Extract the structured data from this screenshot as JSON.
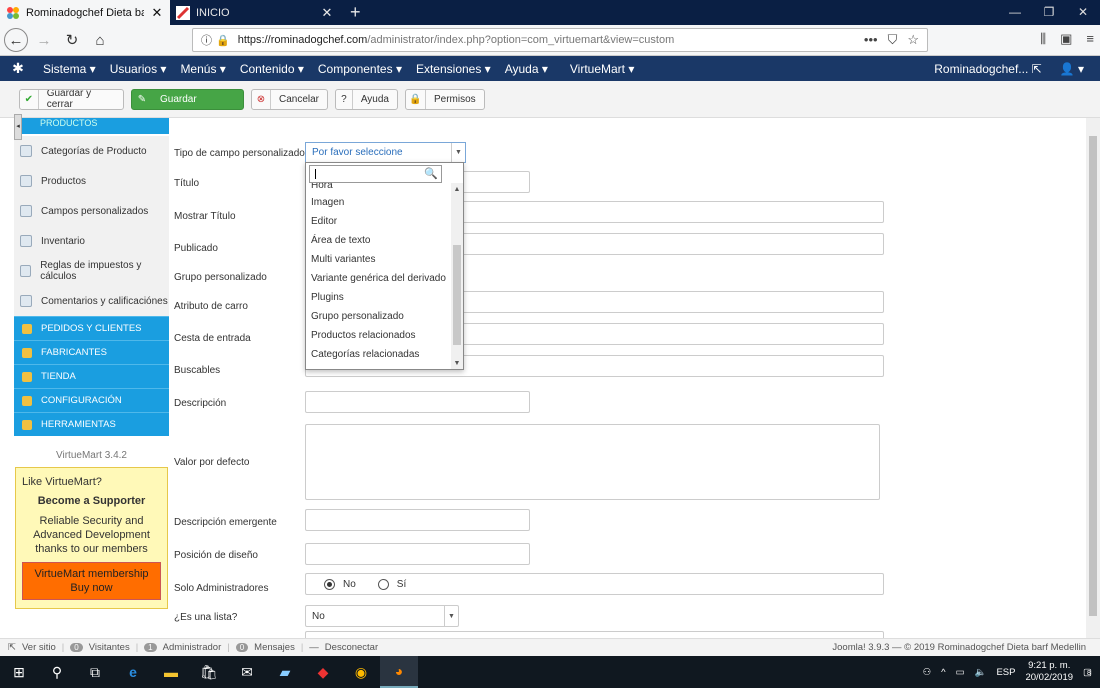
{
  "browser": {
    "tabs": [
      {
        "title": "Rominadogchef Dieta barf Me",
        "active": true
      },
      {
        "title": "INICIO",
        "active": false
      }
    ],
    "new_tab": "+",
    "url_domain": "https://rominadogchef.com",
    "url_path": "/administrator/index.php?option=com_virtuemart&view=custom",
    "url_actions": "•••"
  },
  "joomla_menu": {
    "items": [
      "Sistema ▾",
      "Usuarios ▾",
      "Menús ▾",
      "Contenido ▾",
      "Componentes ▾",
      "Extensiones ▾",
      "Ayuda ▾",
      "VirtueMart ▾"
    ],
    "user": "Rominadogchef... ⇱",
    "user_icon": "👤 ▾"
  },
  "toolbar": {
    "save_close": "Guardar y cerrar",
    "save": "Guardar",
    "cancel": "Cancelar",
    "help": "Ayuda",
    "permissions": "Permisos"
  },
  "sidebar": {
    "header": "PRODUCTOS",
    "items": [
      {
        "label": "Categorías de Producto"
      },
      {
        "label": "Productos"
      },
      {
        "label": "Campos personalizados"
      },
      {
        "label": "Inventario"
      },
      {
        "label": "Reglas de impuestos y cálculos"
      },
      {
        "label": "Comentarios y calificaciónes"
      }
    ],
    "sections": [
      {
        "label": "PEDIDOS Y CLIENTES"
      },
      {
        "label": "FABRICANTES"
      },
      {
        "label": "TIENDA"
      },
      {
        "label": "CONFIGURACIÓN"
      },
      {
        "label": "HERRAMIENTAS"
      }
    ],
    "version": "VirtueMart 3.4.2",
    "promo": {
      "like": "Like VirtueMart?",
      "become": "Become a Supporter",
      "desc": "Reliable Security and Advanced Development thanks to our members",
      "buy": "VirtueMart membership Buy now"
    }
  },
  "form": {
    "labels": {
      "field_type": "Tipo de campo personalizado",
      "title": "Título",
      "show_title": "Mostrar Título",
      "published": "Publicado",
      "custom_group": "Grupo personalizado",
      "cart_attribute": "Atributo de carro",
      "input_cart": "Cesta de entrada",
      "searchable": "Buscables",
      "description": "Descripción",
      "default_value": "Valor por defecto",
      "tooltip": "Descripción emergente",
      "layout_position": "Posición de diseño",
      "admin_only": "Solo Administradores",
      "is_list": "¿Es una lista?"
    },
    "field_type_placeholder": "Por favor seleccione",
    "admin_only_options": {
      "no": "No",
      "yes": "Sí",
      "selected": "No"
    },
    "is_list_value": "No"
  },
  "dropdown": {
    "search_value": "",
    "options": [
      "Hora",
      "Imagen",
      "Editor",
      "Área de texto",
      "Multi variantes",
      "Variante genérica del derivado",
      "Plugins",
      "Grupo personalizado",
      "Productos relacionados",
      "Categorías relacionadas"
    ]
  },
  "statusbar": {
    "view_site": "Ver sitio",
    "visitors_count": "0",
    "visitors": "Visitantes",
    "admin_count": "1",
    "admin": "Administrador",
    "messages_count": "0",
    "messages": "Mensajes",
    "logout": "Desconectar",
    "footer": "Joomla! 3.9.3 — © 2019 Rominadogchef Dieta barf Medellin"
  },
  "taskbar": {
    "lang": "ESP",
    "time": "9:21 p. m.",
    "date": "20/02/2019",
    "notif": "8"
  },
  "colors": {
    "menu_bg": "#1a3867",
    "sidebar_blue": "#1a9ee0",
    "save_green": "#46a546",
    "promo_yellow": "#fff9b8",
    "promo_orange": "#ff6d00"
  }
}
